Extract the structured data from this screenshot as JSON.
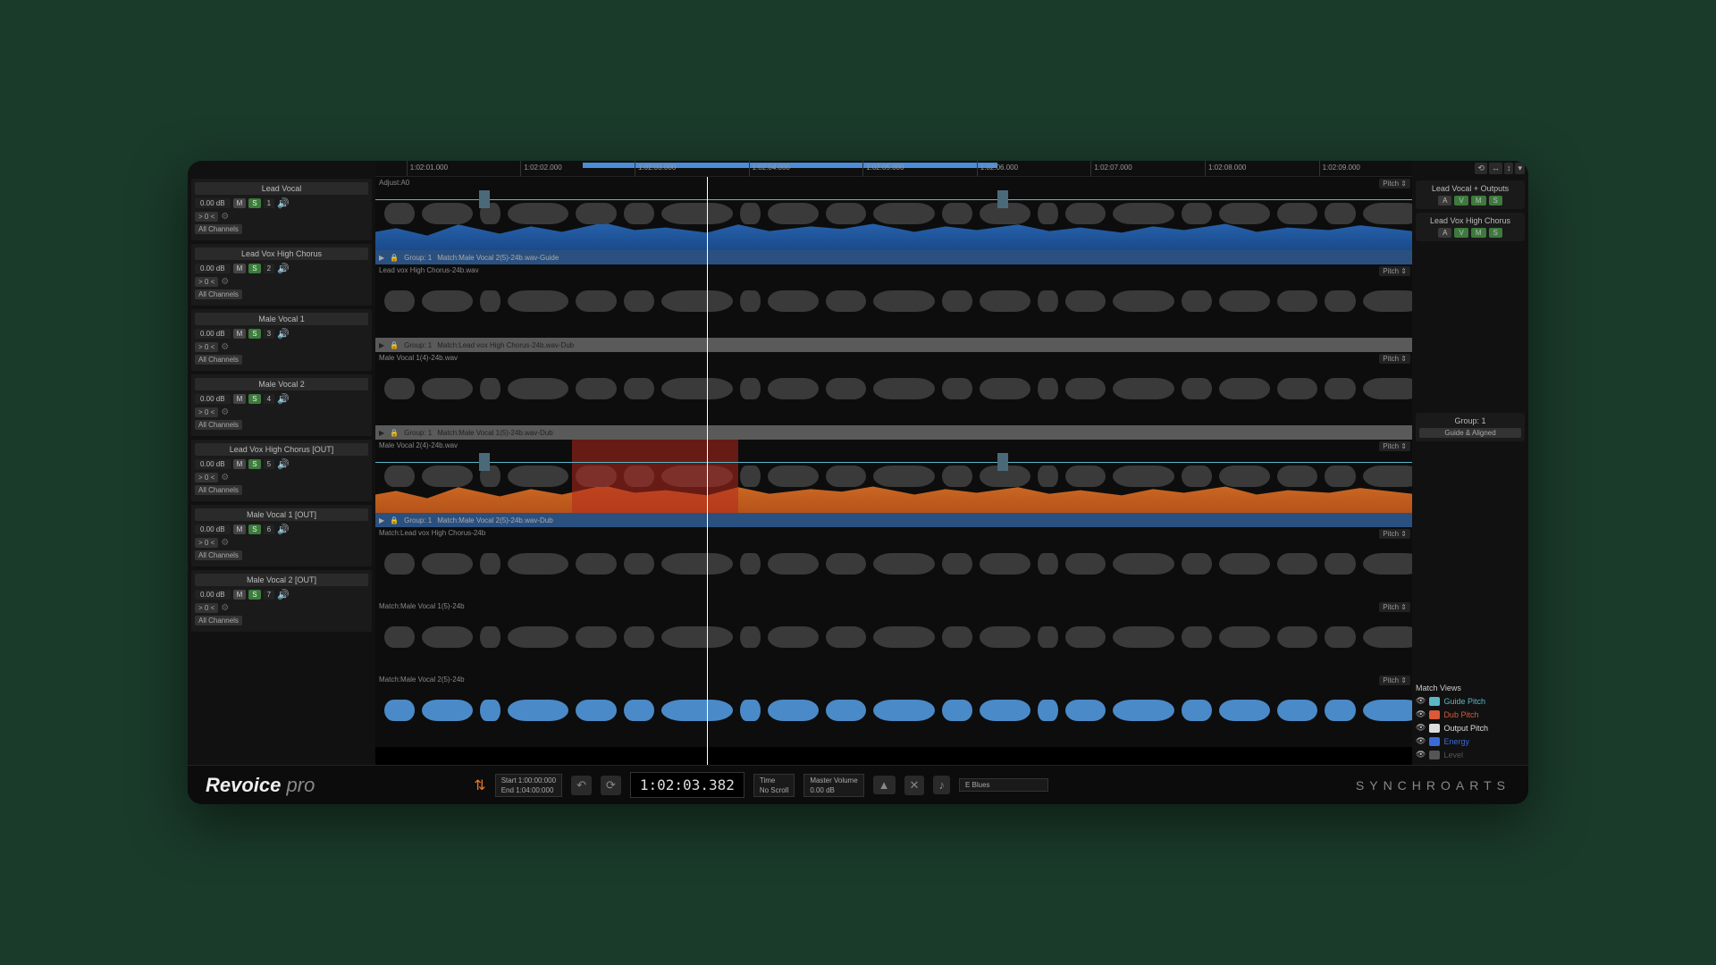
{
  "timeline": {
    "ticks": [
      "1:02:01.000",
      "1:02:02.000",
      "1:02:03.000",
      "1:02:04.000",
      "1:02:05.000",
      "1:02:06.000",
      "1:02:07.000",
      "1:02:08.000",
      "1:02:09.000"
    ]
  },
  "tracks": [
    {
      "name": "Lead Vocal",
      "db": "0.00 dB",
      "pan": "> 0 <",
      "idx": "1",
      "channels": "All Channels",
      "clip": "Adjust:A0",
      "group": "Group: 1",
      "match": "Match:Male Vocal  2(5)-24b.wav-Guide",
      "fill": "blue",
      "pitch": "Pitch",
      "barClass": "blue"
    },
    {
      "name": "Lead Vox High Chorus",
      "db": "0.00 dB",
      "pan": "> 0 <",
      "idx": "2",
      "channels": "All Channels",
      "clip": "Lead vox High Chorus-24b.wav",
      "group": "Group: 1",
      "match": "Match:Lead vox High Chorus-24b.wav-Dub",
      "fill": "",
      "pitch": "Pitch",
      "barClass": "gray"
    },
    {
      "name": "Male Vocal  1",
      "db": "0.00 dB",
      "pan": "> 0 <",
      "idx": "3",
      "channels": "All Channels",
      "clip": "Male Vocal  1(4)-24b.wav",
      "group": "Group: 1",
      "match": "Match:Male Vocal  1(5)-24b.wav-Dub",
      "fill": "",
      "pitch": "Pitch",
      "barClass": "gray"
    },
    {
      "name": "Male Vocal  2",
      "db": "0.00 dB",
      "pan": "> 0 <",
      "idx": "4",
      "channels": "All Channels",
      "clip": "Male Vocal  2(4)-24b.wav",
      "group": "Group: 1",
      "match": "Match:Male Vocal  2(5)-24b.wav-Dub",
      "fill": "orange",
      "pitch": "Pitch",
      "barClass": "blue",
      "red": true
    },
    {
      "name": "Lead Vox High Chorus  [OUT]",
      "db": "0.00 dB",
      "pan": "> 0 <",
      "idx": "5",
      "channels": "All Channels",
      "clip": "Match:Lead vox High Chorus-24b",
      "group": "",
      "match": "",
      "fill": "",
      "pitch": "Pitch",
      "barClass": ""
    },
    {
      "name": "Male Vocal  1  [OUT]",
      "db": "0.00 dB",
      "pan": "> 0 <",
      "idx": "6",
      "channels": "All Channels",
      "clip": "Match:Male Vocal  1(5)-24b",
      "group": "",
      "match": "",
      "fill": "",
      "pitch": "Pitch",
      "barClass": ""
    },
    {
      "name": "Male Vocal  2  [OUT]",
      "db": "0.00 dB",
      "pan": "> 0 <",
      "idx": "7",
      "channels": "All Channels",
      "clip": "Match:Male Vocal  2(5)-24b",
      "group": "",
      "match": "",
      "fill": "bluewf",
      "pitch": "Pitch",
      "barClass": ""
    }
  ],
  "right": {
    "outputs": [
      {
        "title": "Lead Vocal + Outputs",
        "btns": [
          "A",
          "V",
          "M",
          "S"
        ]
      },
      {
        "title": "Lead Vox High Chorus",
        "btns": [
          "A",
          "V",
          "M",
          "S"
        ]
      }
    ],
    "group": {
      "title": "Group: 1",
      "mode": "Guide & Aligned"
    },
    "matchViews": {
      "title": "Match Views",
      "items": [
        {
          "label": "Guide Pitch",
          "color": "#5ab8c8"
        },
        {
          "label": "Dub Pitch",
          "color": "#d85a3a"
        },
        {
          "label": "Output Pitch",
          "color": "#ddd"
        },
        {
          "label": "Energy",
          "color": "#3a6ad8"
        },
        {
          "label": "Level",
          "color": "#555"
        }
      ]
    }
  },
  "footer": {
    "brand1": "Revoice",
    "brand2": "pro",
    "start": "Start  1:00:00:000",
    "end": "End    1:04:00:000",
    "timecode": "1:02:03.382",
    "time": "Time",
    "noscroll": "No Scroll",
    "master": "Master Volume",
    "mdb": "0.00 dB",
    "key": "E Blues",
    "synchro": "SYNCHROARTS"
  },
  "labels": {
    "m": "M",
    "s": "S",
    "pitch": "Pitch"
  }
}
